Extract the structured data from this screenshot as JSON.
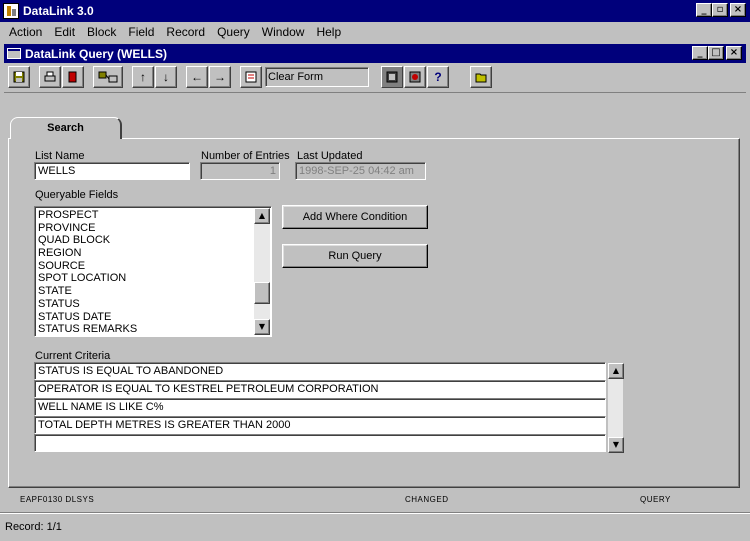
{
  "app": {
    "title": "DataLink 3.0"
  },
  "menu": [
    "Action",
    "Edit",
    "Block",
    "Field",
    "Record",
    "Query",
    "Window",
    "Help"
  ],
  "document": {
    "title": "DataLink Query (WELLS)"
  },
  "toolbar": {
    "clear_form_label": "Clear Form",
    "icons": [
      "save-icon",
      "print-icon",
      "exit-icon",
      "connect-icon",
      "arrow-up-icon",
      "arrow-down-icon",
      "arrow-left-icon",
      "arrow-right-icon",
      "clear-form-icon",
      "query-icon",
      "cancel-query-icon",
      "help-icon",
      "open-folder-icon"
    ]
  },
  "tab": {
    "label": "Search"
  },
  "form": {
    "list_name_label": "List Name",
    "list_name_value": "WELLS",
    "entries_label": "Number of Entries",
    "entries_value": "1",
    "updated_label": "Last Updated",
    "updated_value": "1998-SEP-25 04:42 am",
    "queryable_label": "Queryable Fields",
    "queryable_fields": [
      "PROSPECT",
      "PROVINCE",
      "QUAD BLOCK",
      "REGION",
      "SOURCE",
      "SPOT LOCATION",
      "STATE",
      "STATUS",
      "STATUS DATE",
      "STATUS REMARKS"
    ],
    "add_where_label": "Add Where Condition",
    "run_query_label": "Run Query",
    "criteria_label": "Current Criteria",
    "criteria": [
      "STATUS IS EQUAL TO ABANDONED",
      "OPERATOR IS EQUAL TO KESTREL PETROLEUM CORPORATION",
      "WELL NAME IS LIKE C%",
      "TOTAL DEPTH METRES IS GREATER THAN 2000",
      ""
    ]
  },
  "status": {
    "left": "EAPF0130 DLSYS",
    "center": "CHANGED",
    "right": "QUERY",
    "record": "Record: 1/1"
  }
}
